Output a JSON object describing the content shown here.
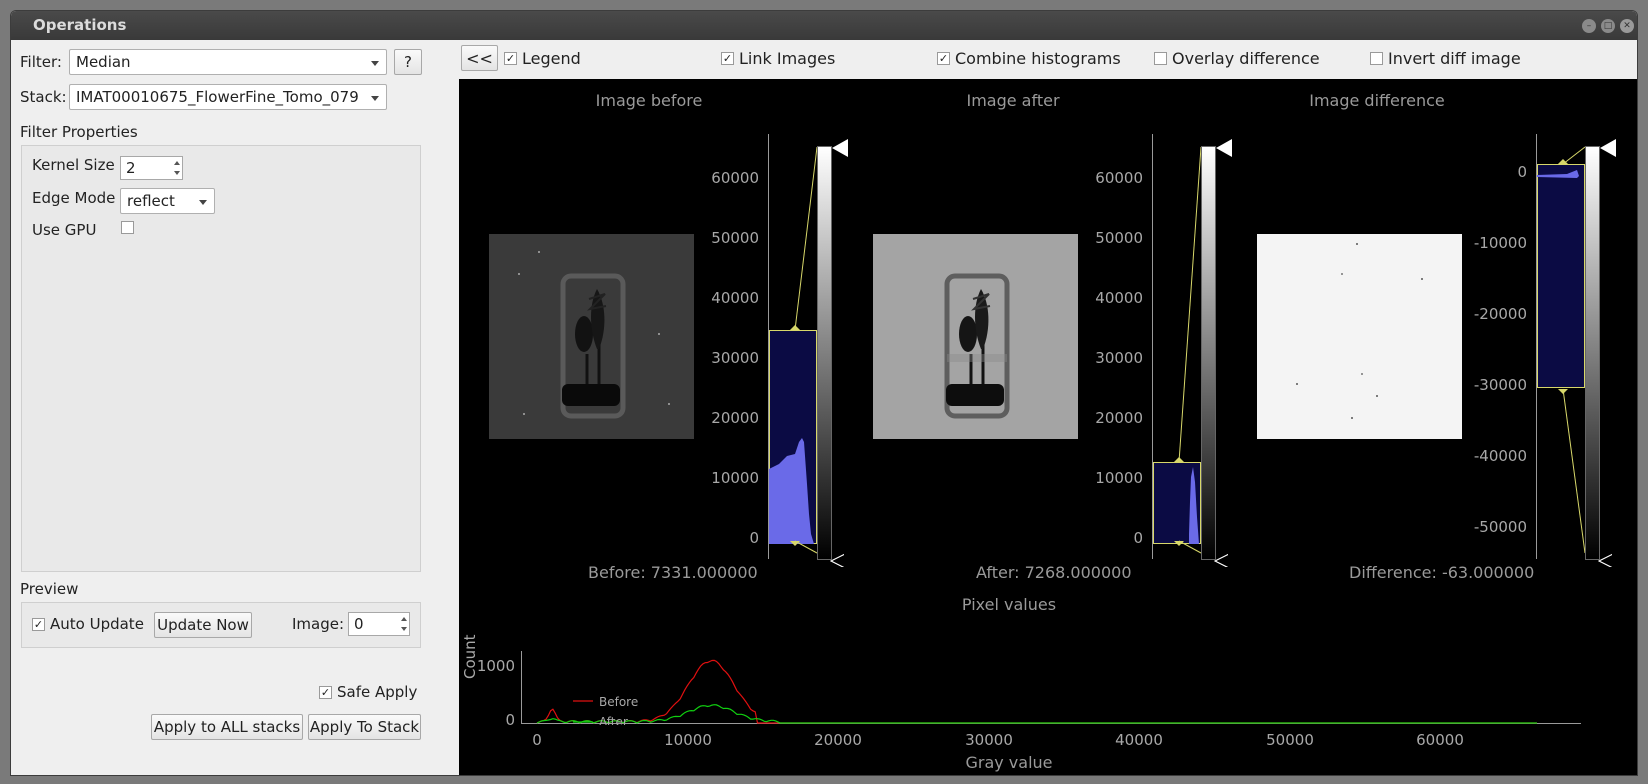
{
  "window": {
    "title": "Operations"
  },
  "left": {
    "filter_label": "Filter:",
    "filter_value": "Median",
    "help_button": "?",
    "stack_label": "Stack:",
    "stack_value": "IMAT00010675_FlowerFine_Tomo_079",
    "filter_properties_label": "Filter Properties",
    "kernel_size_label": "Kernel Size",
    "kernel_size_value": "2",
    "edge_mode_label": "Edge Mode",
    "edge_mode_value": "reflect",
    "use_gpu_label": "Use GPU",
    "use_gpu_checked": false,
    "preview_label": "Preview",
    "auto_update_label": "Auto Update",
    "auto_update_checked": true,
    "update_now_label": "Update Now",
    "image_label": "Image:",
    "image_value": "0",
    "safe_apply_label": "Safe Apply",
    "safe_apply_checked": true,
    "apply_all_label": "Apply to ALL stacks",
    "apply_stack_label": "Apply To Stack"
  },
  "toolbar": {
    "collapse_label": "<<",
    "legend_label": "Legend",
    "legend_checked": true,
    "link_images_label": "Link Images",
    "link_images_checked": true,
    "combine_hist_label": "Combine histograms",
    "combine_hist_checked": true,
    "overlay_diff_label": "Overlay difference",
    "overlay_diff_checked": false,
    "invert_diff_label": "Invert diff image",
    "invert_diff_checked": false
  },
  "views": {
    "before_title": "Image before",
    "after_title": "Image after",
    "diff_title": "Image difference",
    "before_readout": "Before: 7331.000000",
    "after_readout": "After: 7268.000000",
    "diff_readout": "Difference: -63.000000",
    "hist_ticks_pos": [
      "60000",
      "50000",
      "40000",
      "30000",
      "20000",
      "10000",
      "0"
    ],
    "hist_ticks_diff": [
      "0",
      "-10000",
      "-20000",
      "-30000",
      "-40000",
      "-50000"
    ]
  },
  "pixel_plot": {
    "title": "Pixel values",
    "ylabel": "Count",
    "xlabel": "Gray value",
    "yticks": [
      "1000",
      "0"
    ],
    "xticks": [
      "0",
      "10000",
      "20000",
      "30000",
      "40000",
      "50000",
      "60000"
    ],
    "legend_before": "Before",
    "legend_after": "After",
    "colors": {
      "before": "#e01010",
      "after": "#10d010"
    }
  }
}
